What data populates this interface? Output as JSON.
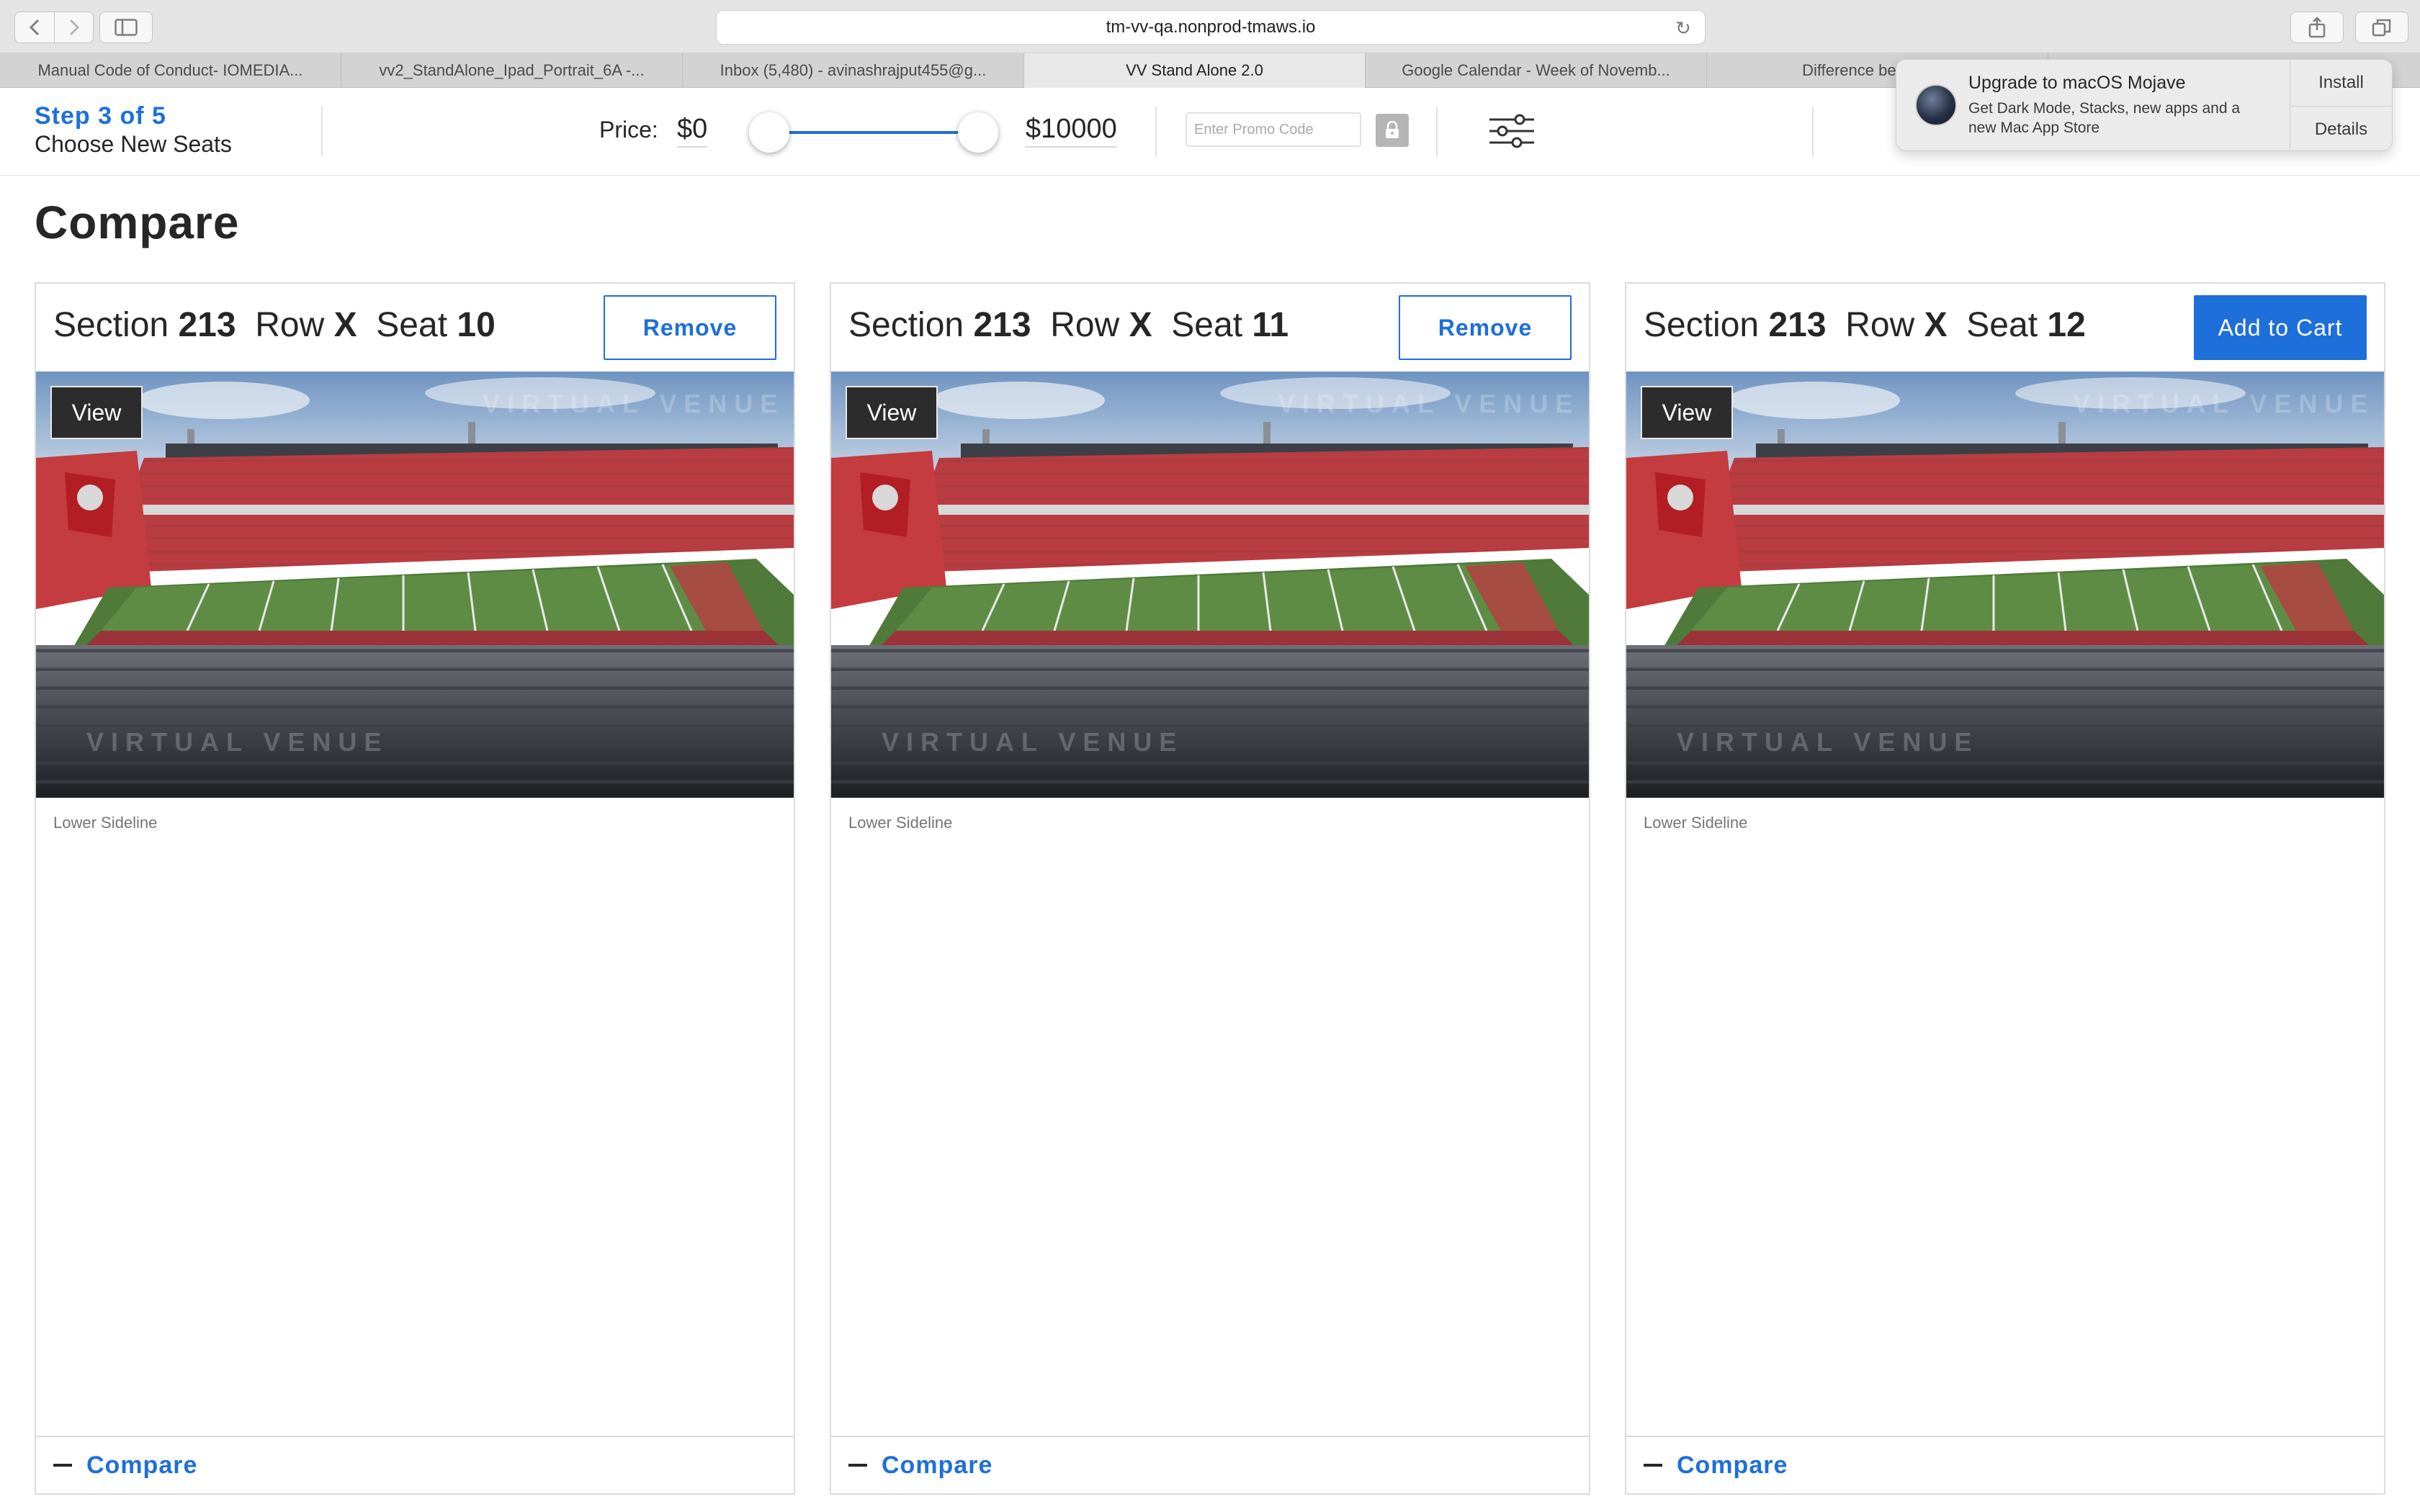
{
  "browser": {
    "url": "tm-vv-qa.nonprod-tmaws.io",
    "tabs": [
      {
        "label": "Manual Code of Conduct- IOMEDIA...",
        "active": false
      },
      {
        "label": "vv2_StandAlone_Ipad_Portrait_6A -...",
        "active": false
      },
      {
        "label": "Inbox (5,480) - avinashrajput455@g...",
        "active": false
      },
      {
        "label": "VV Stand Alone 2.0",
        "active": true
      },
      {
        "label": "Google Calendar - Week of Novemb...",
        "active": false
      },
      {
        "label": "Difference between A",
        "active": false
      }
    ]
  },
  "notification": {
    "title": "Upgrade to macOS Mojave",
    "body": "Get Dark Mode, Stacks, new apps and a new Mac App Store",
    "install_label": "Install",
    "details_label": "Details"
  },
  "header": {
    "step": "Step 3 of 5",
    "step_title": "Choose New Seats",
    "price_label": "Price:",
    "price_min": "$0",
    "price_max": "$10000",
    "promo_placeholder": "Enter Promo Code"
  },
  "page": {
    "title": "Compare"
  },
  "cards": [
    {
      "section_word": "Section",
      "section": "213",
      "row_word": "Row",
      "row": "X",
      "seat_word": "Seat",
      "seat": "10",
      "action_label": "Remove",
      "action_style": "outline",
      "view_label": "View",
      "section_type": "Lower Sideline",
      "compare_label": "Compare"
    },
    {
      "section_word": "Section",
      "section": "213",
      "row_word": "Row",
      "row": "X",
      "seat_word": "Seat",
      "seat": "11",
      "action_label": "Remove",
      "action_style": "outline",
      "view_label": "View",
      "section_type": "Lower Sideline",
      "compare_label": "Compare"
    },
    {
      "section_word": "Section",
      "section": "213",
      "row_word": "Row",
      "row": "X",
      "seat_word": "Seat",
      "seat": "12",
      "action_label": "Add to Cart",
      "action_style": "solid",
      "view_label": "View",
      "section_type": "Lower Sideline",
      "compare_label": "Compare"
    }
  ],
  "watermark": "VIRTUAL VENUE",
  "colors": {
    "accent": "#1e6fd9",
    "text": "#262626",
    "muted": "#757575"
  }
}
